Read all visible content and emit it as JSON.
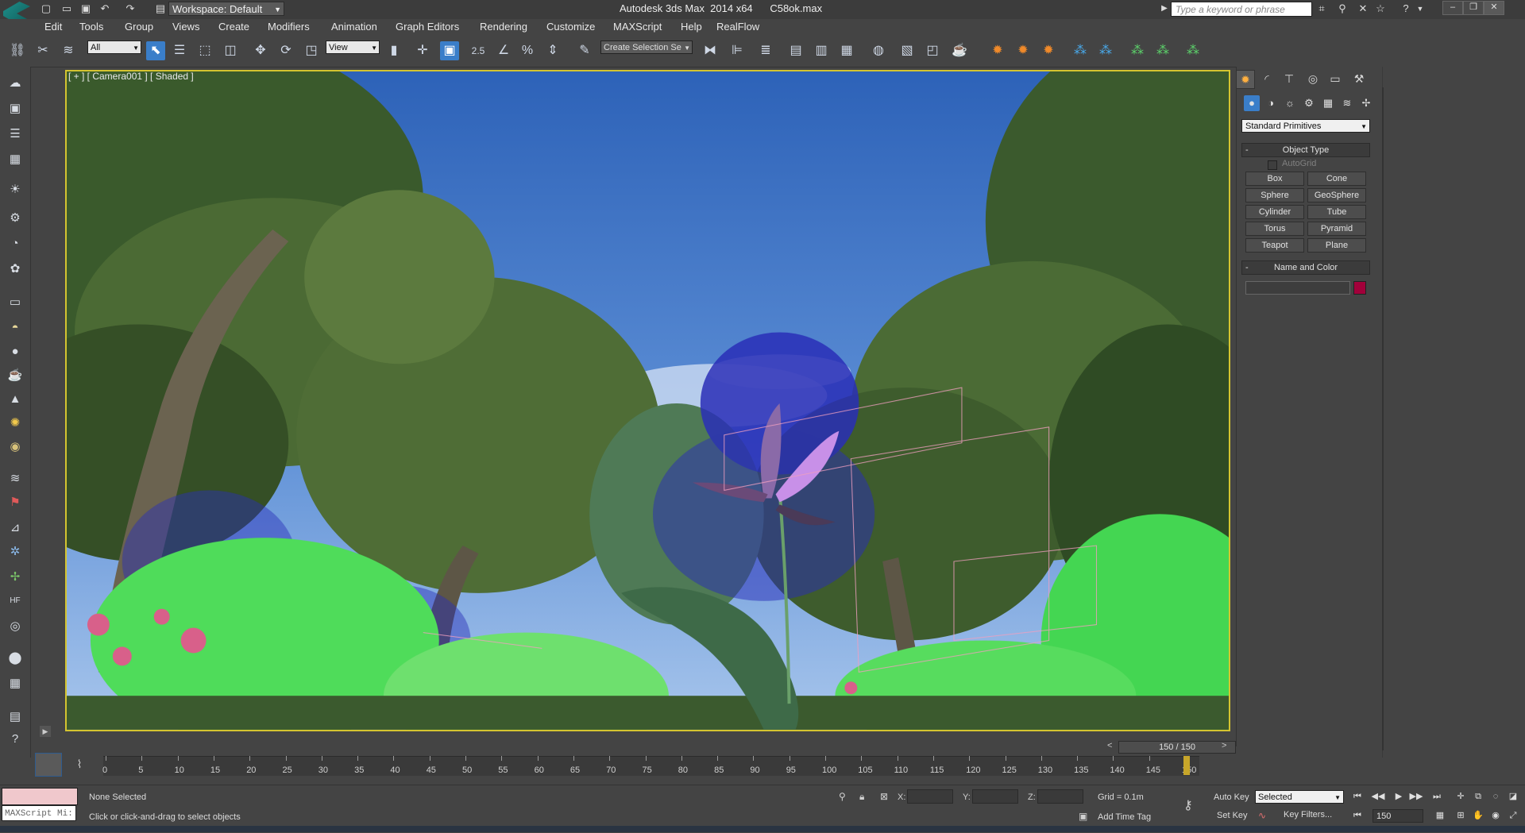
{
  "titlebar": {
    "workspace_label": "Workspace: Default",
    "title": "Autodesk 3ds Max  2014 x64      C58ok.max",
    "search_placeholder": "Type a keyword or phrase"
  },
  "menu": [
    "Edit",
    "Tools",
    "Group",
    "Views",
    "Create",
    "Modifiers",
    "Animation",
    "Graph Editors",
    "Rendering",
    "Customize",
    "MAXScript",
    "Help",
    "RealFlow"
  ],
  "toolbar": {
    "selection_filter": "All",
    "ref_coord": "View",
    "snap_value": "2.5",
    "named_selection": "Create Selection Se"
  },
  "viewport": {
    "label": "[ + ] [ Camera001 ] [ Shaded ]"
  },
  "command_panel": {
    "category": "Standard Primitives",
    "object_type_title": "Object Type",
    "autogrid_label": "AutoGrid",
    "buttons": [
      "Box",
      "Cone",
      "Sphere",
      "GeoSphere",
      "Cylinder",
      "Tube",
      "Torus",
      "Pyramid",
      "Teapot",
      "Plane"
    ],
    "name_color_title": "Name and Color",
    "object_color": "#a2003a"
  },
  "timeline": {
    "slider_label": "150 / 150",
    "ticks": [
      "0",
      "5",
      "10",
      "15",
      "20",
      "25",
      "30",
      "35",
      "40",
      "45",
      "50",
      "55",
      "60",
      "65",
      "70",
      "75",
      "80",
      "85",
      "90",
      "95",
      "100",
      "105",
      "110",
      "115",
      "120",
      "125",
      "130",
      "135",
      "140",
      "145",
      "150"
    ]
  },
  "status": {
    "maxscript_label": "MAXScript Mi:",
    "selection": "None Selected",
    "prompt": "Click or click-and-drag to select objects",
    "x_label": "X:",
    "y_label": "Y:",
    "z_label": "Z:",
    "grid": "Grid = 0.1m",
    "add_time_tag": "Add Time Tag",
    "auto_key": "Auto Key",
    "set_key": "Set Key",
    "key_mode": "Selected",
    "key_filters": "Key Filters...",
    "current_frame": "150"
  }
}
